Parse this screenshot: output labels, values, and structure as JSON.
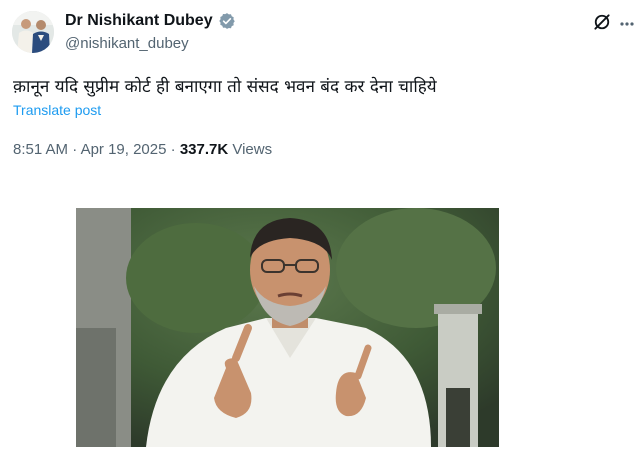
{
  "author": {
    "display_name": "Dr Nishikant Dubey",
    "handle": "@nishikant_dubey",
    "verified": true,
    "verified_badge_color": "#829aab"
  },
  "post": {
    "text": "क़ानून यदि सुप्रीम कोर्ट ही बनाएगा तो संसद भवन बंद कर देना चाहिये",
    "translate_label": "Translate post",
    "time": "8:51 AM",
    "date": "Apr 19, 2025",
    "separator": "·",
    "views_count": "337.7K",
    "views_label": "Views"
  },
  "icons": {
    "avatar": "avatar-photo",
    "grok": "grok-icon",
    "more": "more-options-icon"
  },
  "colors": {
    "link": "#1d9bf0",
    "secondary_text": "#536471",
    "primary_text": "#0f1419"
  }
}
